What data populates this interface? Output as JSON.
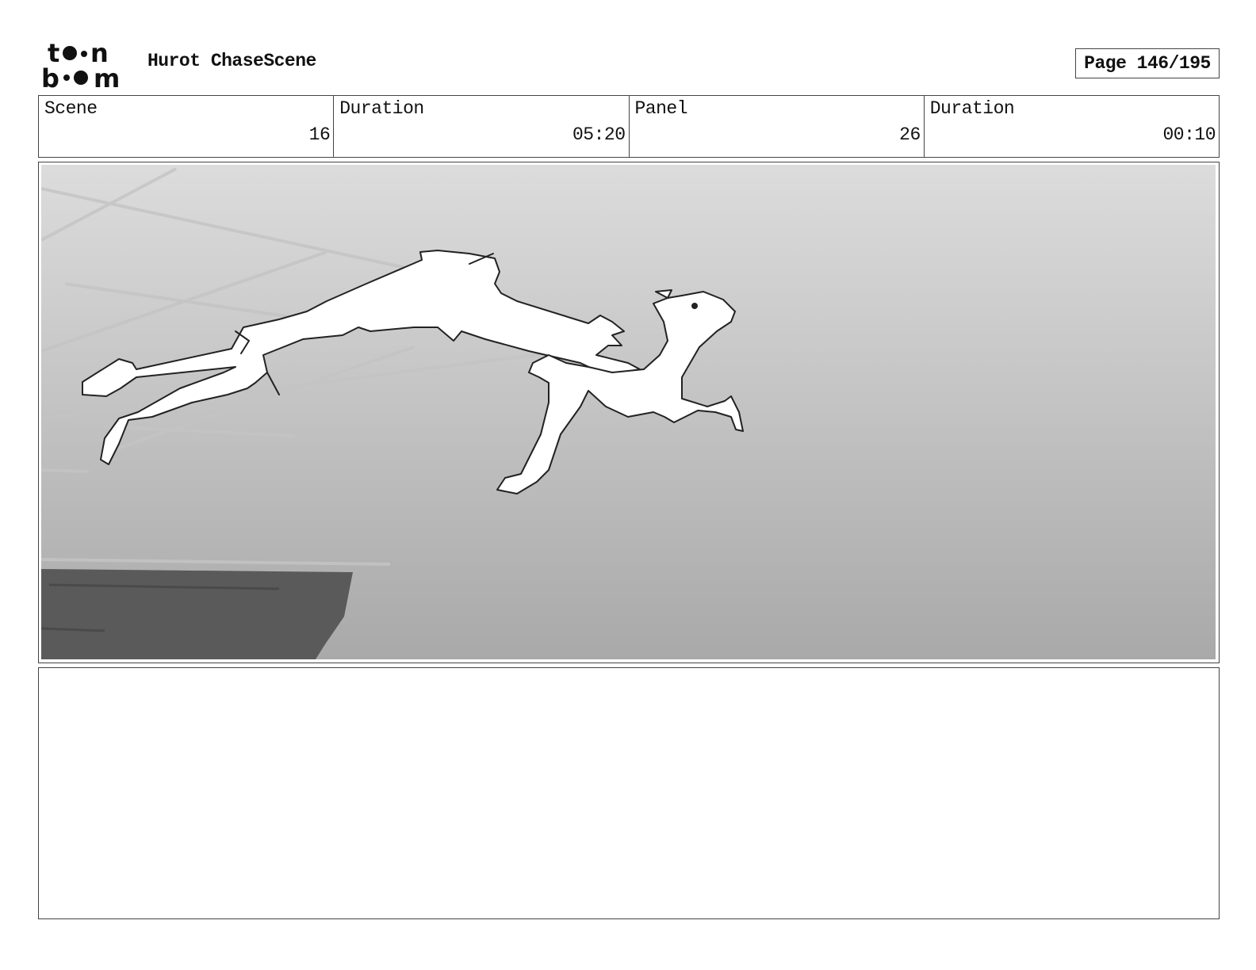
{
  "header": {
    "logo_text": "toon boom",
    "title": "Hurot ChaseScene",
    "page_label": "Page 146/195"
  },
  "info": {
    "scene_label": "Scene",
    "scene_value": "16",
    "scene_duration_label": "Duration",
    "scene_duration_value": "05:20",
    "panel_label": "Panel",
    "panel_value": "26",
    "panel_duration_label": "Duration",
    "panel_duration_value": "00:10"
  },
  "panel": {
    "subject_icons": [
      "leaping-figure-icon",
      "running-deer-icon",
      "cliff-edge-icon"
    ]
  },
  "notes": {
    "text": ""
  }
}
